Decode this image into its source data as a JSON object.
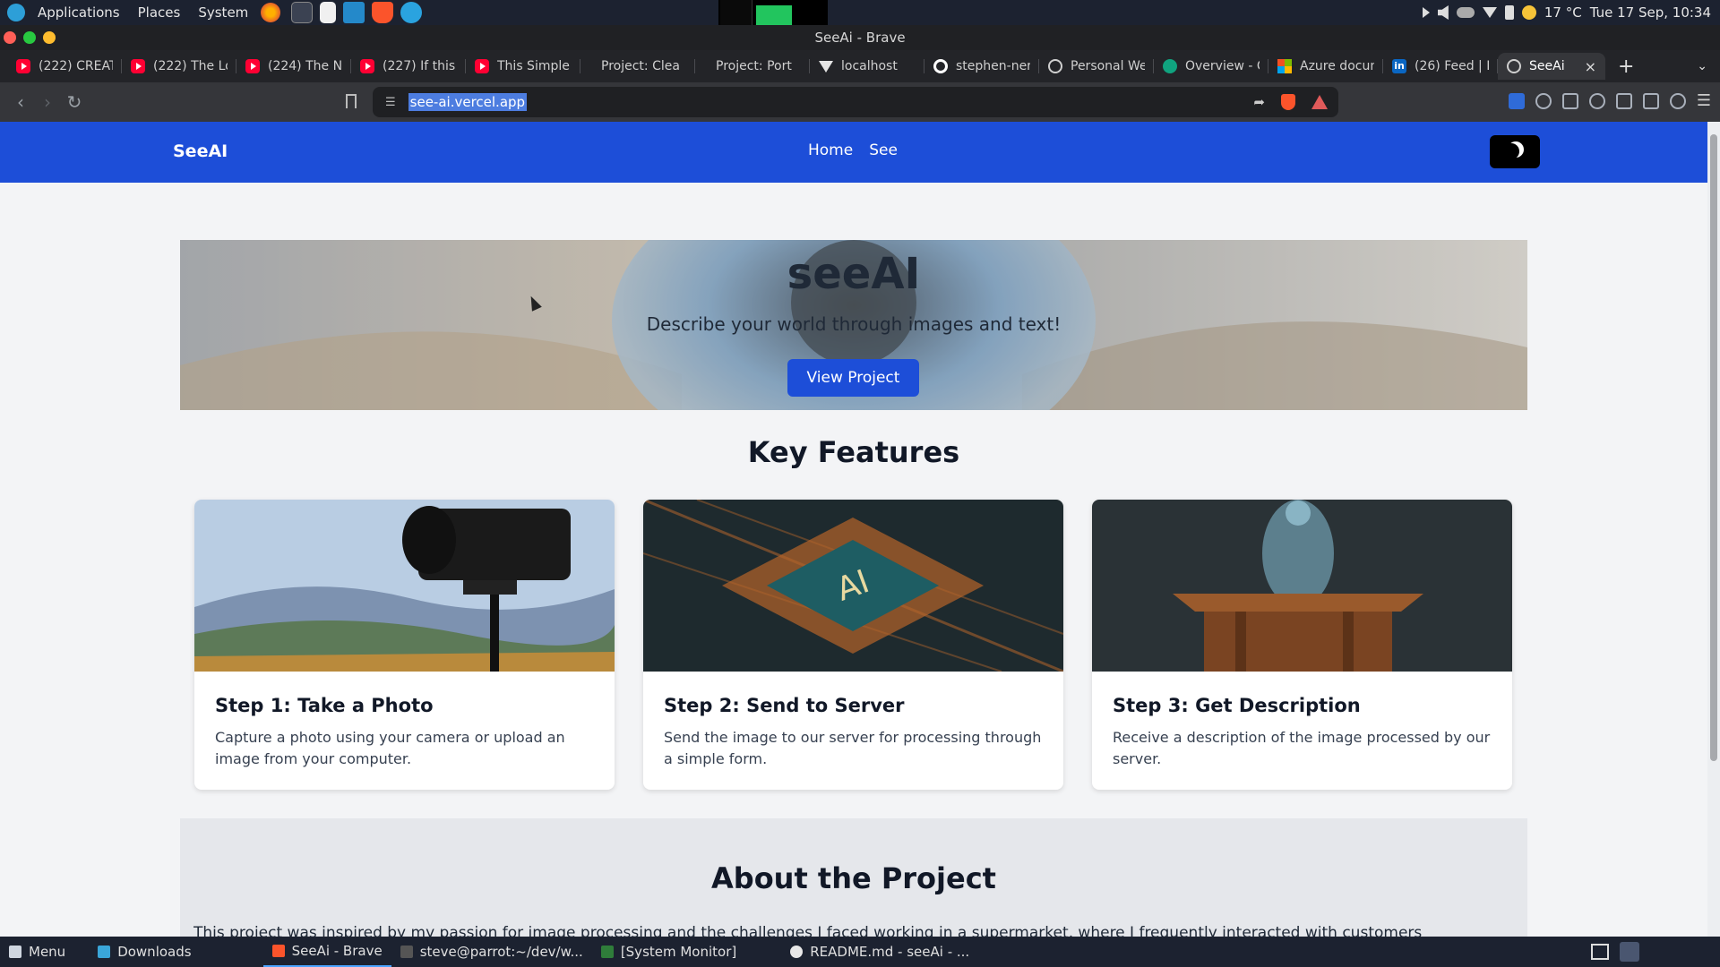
{
  "system_panel": {
    "menus": [
      "Applications",
      "Places",
      "System"
    ],
    "weather": "17 °C",
    "clock": "Tue 17 Sep, 10:34"
  },
  "window": {
    "title": "SeeAi - Brave"
  },
  "tabs": [
    {
      "label": "(222) CREAT",
      "icon": "youtube-icon"
    },
    {
      "label": "(222) The Lo",
      "icon": "youtube-icon"
    },
    {
      "label": "(224) The N",
      "icon": "youtube-icon"
    },
    {
      "label": "(227) If this",
      "icon": "youtube-icon"
    },
    {
      "label": "This Simple",
      "icon": "youtube-icon"
    },
    {
      "label": "Project: Clea",
      "icon": "blank-icon"
    },
    {
      "label": "Project: Port",
      "icon": "blank-icon"
    },
    {
      "label": "localhost",
      "icon": "vercel-icon"
    },
    {
      "label": "stephen-ner",
      "icon": "github-icon"
    },
    {
      "label": "Personal We",
      "icon": "openai-icon"
    },
    {
      "label": "Overview - C",
      "icon": "overview-icon"
    },
    {
      "label": "Azure docun",
      "icon": "microsoft-icon"
    },
    {
      "label": "(26) Feed | L",
      "icon": "linkedin-icon"
    }
  ],
  "active_tab": {
    "label": "SeeAi",
    "close": "×"
  },
  "new_tab": "+",
  "address_bar": {
    "url": "see-ai.vercel.app"
  },
  "site": {
    "brand": "SeeAI",
    "nav": [
      "Home",
      "See"
    ],
    "hero": {
      "title": "seeAI",
      "subtitle": "Describe your world through images and text!",
      "button": "View Project"
    },
    "features_title": "Key Features",
    "features": [
      {
        "title": "Step 1: Take a Photo",
        "desc": "Capture a photo using your camera or upload an image from your computer."
      },
      {
        "title": "Step 2: Send to Server",
        "desc": "Send the image to our server for processing through a simple form."
      },
      {
        "title": "Step 3: Get Description",
        "desc": "Receive a description of the image processed by our server."
      }
    ],
    "about": {
      "title": "About the Project",
      "text": "This project was inspired by my passion for image processing and the challenges I faced working in a supermarket, where I frequently interacted with customers"
    }
  },
  "taskbar": [
    {
      "label": "Menu"
    },
    {
      "label": "Downloads"
    },
    {
      "label": "SeeAi - Brave"
    },
    {
      "label": "steve@parrot:~/dev/w..."
    },
    {
      "label": "[System Monitor]"
    },
    {
      "label": "README.md - seeAi - ..."
    }
  ],
  "colors": {
    "brand_blue": "#1d4ed8",
    "panel": "#1c2230"
  }
}
